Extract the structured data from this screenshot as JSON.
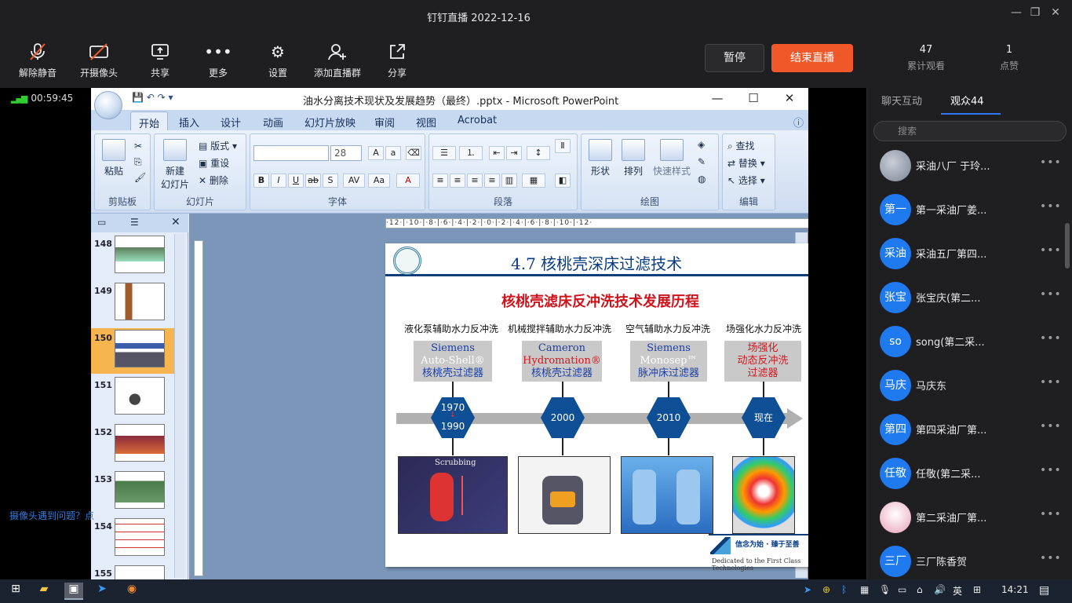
{
  "app": {
    "title": "钉钉直播 2022-12-16"
  },
  "window_controls": {
    "minimize": "—",
    "restore": "❐",
    "close": "✕"
  },
  "toolbar": {
    "unmute": "解除静音",
    "camera": "开摄像头",
    "share": "共享",
    "more": "更多",
    "settings": "设置",
    "add_group": "添加直播群",
    "share_link": "分享",
    "pause": "暂停",
    "end_live": "结束直播"
  },
  "stats": {
    "views": "47",
    "views_label": "累计观看",
    "likes": "1",
    "likes_label": "点赞"
  },
  "live": {
    "timer": "00:59:45",
    "cam_hint": "摄像头遇到问题？点"
  },
  "ppt": {
    "title": "油水分离技术现状及发展趋势（最终）.pptx - Microsoft PowerPoint",
    "tabs": [
      "开始",
      "插入",
      "设计",
      "动画",
      "幻灯片放映",
      "审阅",
      "视图",
      "Acrobat"
    ],
    "active_tab": "开始",
    "ribbon": {
      "clipboard": {
        "label": "剪贴板",
        "paste": "粘贴"
      },
      "slides": {
        "label": "幻灯片",
        "new_slide": "新建",
        "new_slide2": "幻灯片",
        "layout": "版式",
        "reset": "重设",
        "delete": "删除"
      },
      "font": {
        "label": "字体",
        "size": "28"
      },
      "paragraph": {
        "label": "段落"
      },
      "drawing": {
        "label": "绘图",
        "shape": "形状",
        "arrange": "排列",
        "quick_style": "快速样式"
      },
      "editing": {
        "label": "编辑",
        "find": "查找",
        "replace": "替换",
        "select": "选择"
      }
    },
    "thumbnails": [
      "148",
      "149",
      "150",
      "151",
      "152",
      "153",
      "154",
      "155"
    ],
    "selected_thumbnail": "150",
    "ruler": "·12·|·10·|·8·|·6·|·4·|·2·|·0·|·2·|·4·|·6·|·8·|·10·|·12·"
  },
  "slide": {
    "title": "4.7  核桃壳深床过滤技术",
    "subtitle": "核桃壳滤床反冲洗技术发展历程",
    "categories": [
      "液化泵辅助水力反冲洗",
      "机械搅拌辅助水力反冲洗",
      "空气辅助水力反冲洗",
      "场强化水力反冲洗"
    ],
    "boxes": [
      {
        "l1": "Siemens",
        "l2": "Auto-Shell®",
        "l3": "核桃壳过滤器"
      },
      {
        "l1": "Cameron",
        "l2": "Hydromation®",
        "l3": "核桃壳过滤器"
      },
      {
        "l1": "Siemens",
        "l2": "Monosep™",
        "l3": "脉冲床过滤器"
      },
      {
        "l1": "场强化",
        "l2": "动态反冲洗",
        "l3": "过滤器"
      }
    ],
    "milestones": [
      {
        "top": "1970",
        "bottom": "1990"
      },
      {
        "top": "2000",
        "bottom": ""
      },
      {
        "top": "2010",
        "bottom": ""
      },
      {
        "top": "现在",
        "bottom": ""
      }
    ],
    "pic1_label": "Scrubbing",
    "footer_cn": "信念为始 · 臻于至善",
    "footer_en": "Dedicated to the First Class Technologies"
  },
  "right_panel": {
    "tab_chat": "聊天互动",
    "tab_audience": "观众44",
    "search_placeholder": "搜索",
    "audience": [
      {
        "avatar": "",
        "name": "采油八厂 于玲..."
      },
      {
        "avatar": "第一",
        "name": "第一采油厂姜..."
      },
      {
        "avatar": "采油",
        "name": "采油五厂第四..."
      },
      {
        "avatar": "张宝",
        "name": "张宝庆(第二..."
      },
      {
        "avatar": "so",
        "name": "song(第二采..."
      },
      {
        "avatar": "马庆",
        "name": "马庆东"
      },
      {
        "avatar": "第四",
        "name": "第四采油厂第..."
      },
      {
        "avatar": "任敬",
        "name": "任敬(第二采..."
      },
      {
        "avatar": "",
        "name": "第二采油厂第..."
      },
      {
        "avatar": "三厂",
        "name": "三厂陈香贺"
      }
    ]
  },
  "taskbar": {
    "clock": "14:21",
    "ime": "英"
  }
}
